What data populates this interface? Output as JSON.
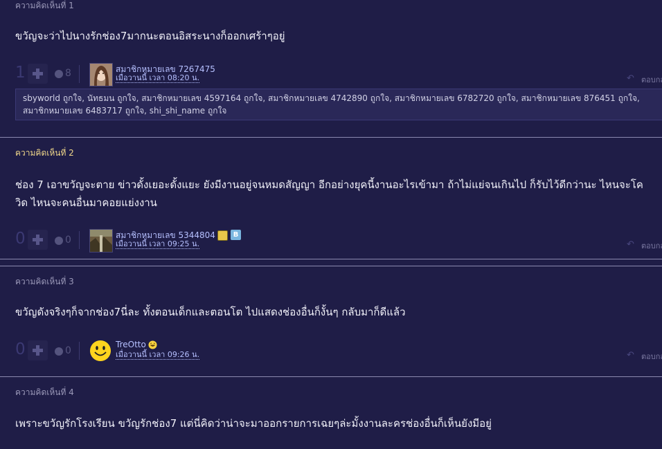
{
  "comments": [
    {
      "number_label": "ความคิดเห็นที่ 1",
      "text": "ขวัญจะว่าไปนางรักช่อง7มากนะตอนอิสระนางก็ออกเศร้าๆอยู่",
      "votes": "1",
      "emotions": "8",
      "member": "สมาชิกหมายเลข 7267475",
      "time": "เมื่อวานนี้ เวลา 08:20 น.",
      "reply": "ตอบกลับ",
      "likes": "sbyworld ถูกใจ, นัทธมน ถูกใจ, สมาชิกหมายเลข 4597164 ถูกใจ, สมาชิกหมายเลข 4742890 ถูกใจ, สมาชิกหมายเลข 6782720 ถูกใจ, สมาชิกหมายเลข 876451 ถูกใจ, สมาชิกหมายเลข 6483717 ถูกใจ, shi_shi_name ถูกใจ",
      "avatar": "woman-photo-avatar"
    },
    {
      "number_label": "ความคิดเห็นที่ 2",
      "text": "ช่อง 7 เอาขวัญจะตาย ข่าวดั้งเยอะดั้งแยะ ยังมีงานอยู่จนหมดสัญญา อีกอย่างยุคนี้งานอะไรเข้ามา ถ้าไม่แย่จนเกินไป ก็รับไว้ดีกว่านะ ไหนจะโควิด ไหนจะคนอื่นมาคอยแย่งงาน",
      "votes": "0",
      "emotions": "0",
      "member": "สมาชิกหมายเลข 5344804",
      "time": "เมื่อวานนี้ เวลา 09:25 น.",
      "reply": "ตอบกลับ",
      "avatar": "landscape-photo-avatar",
      "badges": [
        "yellow-badge-icon",
        "blue-b-badge-icon"
      ]
    },
    {
      "number_label": "ความคิดเห็นที่ 3",
      "text": "ขวัญดังจริงๆก็จากช่อง7นี่ละ ทั้งตอนเด็กและตอนโต ไปแสดงช่องอื่นก็งั้นๆ กลับมาก็ดีแล้ว",
      "votes": "0",
      "emotions": "0",
      "member": "TreOtto",
      "time": "เมื่อวานนี้ เวลา 09:26 น.",
      "reply": "ตอบกลับ",
      "avatar": "smiley-avatar",
      "badges": [
        "laughing-emoji-badge-icon"
      ]
    },
    {
      "number_label": "ความคิดเห็นที่ 4",
      "text": "เพราะขวัญรักโรงเรียน ขวัญรักช่อง7 แต่นี่คิดว่าน่าจะมาออกรายการเฉยๆล่ะมั้งงานละครช่องอื่นก็เห็นยังมีอยู่"
    }
  ],
  "colors": {
    "background": "#1f1d47",
    "highlight_label": "#f0d78a",
    "member_link": "#b6c0ff",
    "likes_box": "#2a2858"
  },
  "icons": {
    "plus": "plus-icon",
    "emotion": "emotion-icon",
    "reply": "reply-arrow-icon"
  }
}
